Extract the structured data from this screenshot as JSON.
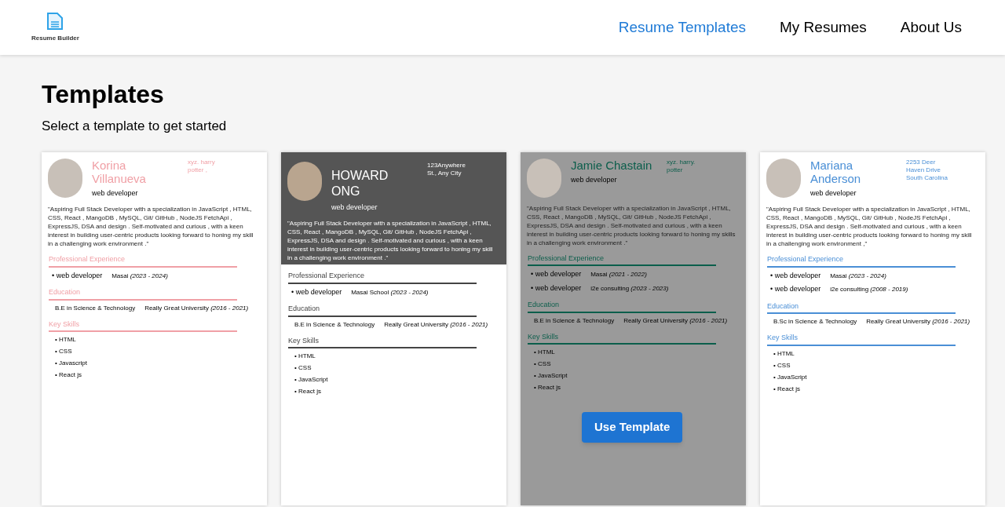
{
  "header": {
    "logo_text": "Resume Builder",
    "nav": [
      {
        "label": "Resume Templates",
        "selected": true
      },
      {
        "label": "My Resumes",
        "selected": false
      },
      {
        "label": "About Us",
        "selected": false
      }
    ]
  },
  "page": {
    "title": "Templates",
    "subtitle": "Select a template to get started"
  },
  "overlay_button": "Use Template",
  "templates": [
    {
      "kind": "plain",
      "color": "#f0a0a6",
      "hovered": false,
      "name": "Korina Villanueva",
      "address": "xyz. harry potter ,",
      "job_title": "web developer",
      "summary": "\"Aspiring Full Stack Developer with a specialization in JavaScript , HTML, CSS, React , MangoDB , MySQL, Git/ GitHub , NodeJS FetchApi , ExpressJS, DSA and design . Self-motivated and curious , with a keen interest in building user-centric products looking forward to honing my skill in a challenging work environment .\"",
      "experience": {
        "heading": "Professional Experience",
        "items": [
          {
            "role": "• web developer",
            "company": "Masai",
            "period": "(2023 - 2024)"
          }
        ]
      },
      "education": {
        "heading": "Education",
        "items": [
          {
            "degree": "B.E in Science & Technology",
            "school": "Really Great University",
            "period": "(2016 - 2021)"
          }
        ]
      },
      "skills": {
        "heading": "Key Skills",
        "items": [
          "• HTML",
          "• CSS",
          "• Javascript",
          "• React js"
        ]
      }
    },
    {
      "kind": "banner",
      "color": "#555555",
      "hovered": false,
      "name": "HOWARD ONG",
      "address": "123Anywhere St., Any City",
      "job_title": "web developer",
      "summary": "\"Aspiring Full Stack Developer with a specialization in JavaScript , HTML, CSS, React , MangoDB , MySQL, Git/ GitHub , NodeJS FetchApi , ExpressJS, DSA and design . Self-motivated and curious , with a keen interest in building user-centric products looking forward to honing my skill in a challenging work environment .\"",
      "experience": {
        "heading": "Professional Experience",
        "items": [
          {
            "role": "• web developer",
            "company": "Masai School",
            "period": "(2023 - 2024)"
          }
        ]
      },
      "education": {
        "heading": "Education",
        "items": [
          {
            "degree": "B.E in Science & Technology",
            "school": "Really Great University",
            "period": "(2016 - 2021)"
          }
        ]
      },
      "skills": {
        "heading": "Key Skills",
        "items": [
          "• HTML",
          "• CSS",
          "• JavaScript",
          "• React js"
        ]
      }
    },
    {
      "kind": "plain",
      "color": "#0b5e4b",
      "hovered": true,
      "name": "Jamie Chastain",
      "address": "xyz. harry. potter",
      "job_title": "web developer",
      "summary": "\"Aspiring Full Stack Developer with a specialization in JavaScript , HTML, CSS, React , MangoDB , MySQL, Git/ GitHub , NodeJS FetchApi , ExpressJS, DSA and design . Self-motivated and curious , with a keen interest in building user-centric products looking forward to honing my skills in a challenging work environment .\"",
      "experience": {
        "heading": "Professional Experience",
        "items": [
          {
            "role": "• web developer",
            "company": "Masai",
            "period": "(2021 - 2022)"
          },
          {
            "role": "• web developer",
            "company": "i2e consulting",
            "period": "(2023 - 2023)"
          }
        ]
      },
      "education": {
        "heading": "Education",
        "items": [
          {
            "degree": "B.E in Science & Technology",
            "school": "Really Great University",
            "period": "(2016 - 2021)"
          }
        ]
      },
      "skills": {
        "heading": "Key Skills",
        "items": [
          "• HTML",
          "• CSS",
          "• JavaScript",
          "• React js"
        ]
      }
    },
    {
      "kind": "plain",
      "color": "#4a8fd6",
      "hovered": false,
      "name": "Mariana Anderson",
      "address": "2253 Deer Haven Drive South Carolina",
      "job_title": "web developer",
      "summary": "\"Aspiring Full Stack Developer with a specialization in JavaScript , HTML, CSS, React , MangoDB , MySQL, Git/ GitHub , NodeJS FetchApi , ExpressJS, DSA and design . Self-motivated and curious , with a keen interest in building user-centric products looking forward to honing my skill in a challenging work environment ,\"",
      "experience": {
        "heading": "Professional Experience",
        "items": [
          {
            "role": "• web developer",
            "company": "Masai",
            "period": "(2023 - 2024)"
          },
          {
            "role": "• web developer",
            "company": "i2e consulting",
            "period": "(2008 - 2019)"
          }
        ]
      },
      "education": {
        "heading": "Education",
        "items": [
          {
            "degree": "B.Sc in Science & Technology",
            "school": "Really Great University",
            "period": "(2016 - 2021)"
          }
        ]
      },
      "skills": {
        "heading": "Key Skills",
        "items": [
          "• HTML",
          "• CSS",
          "• JavaScript",
          "• React js"
        ]
      }
    }
  ]
}
